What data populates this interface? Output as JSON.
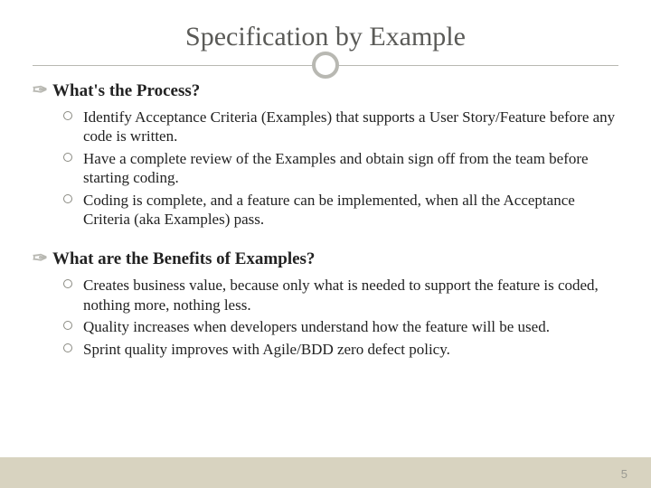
{
  "title": "Specification by Example",
  "sections": [
    {
      "heading": "What's the Process?",
      "items": [
        "Identify Acceptance Criteria (Examples) that supports a User Story/Feature before any code is written.",
        "Have a complete review of the Examples and obtain sign off from the team before starting coding.",
        "Coding is complete, and a feature can be implemented, when all the Acceptance Criteria (aka Examples) pass."
      ]
    },
    {
      "heading": "What are the Benefits of Examples?",
      "items": [
        "Creates business value, because only what is needed to support the feature is coded, nothing more, nothing less.",
        "Quality increases when developers understand how the feature will be used.",
        "Sprint quality improves with Agile/BDD zero defect policy."
      ]
    }
  ],
  "page_number": "5"
}
